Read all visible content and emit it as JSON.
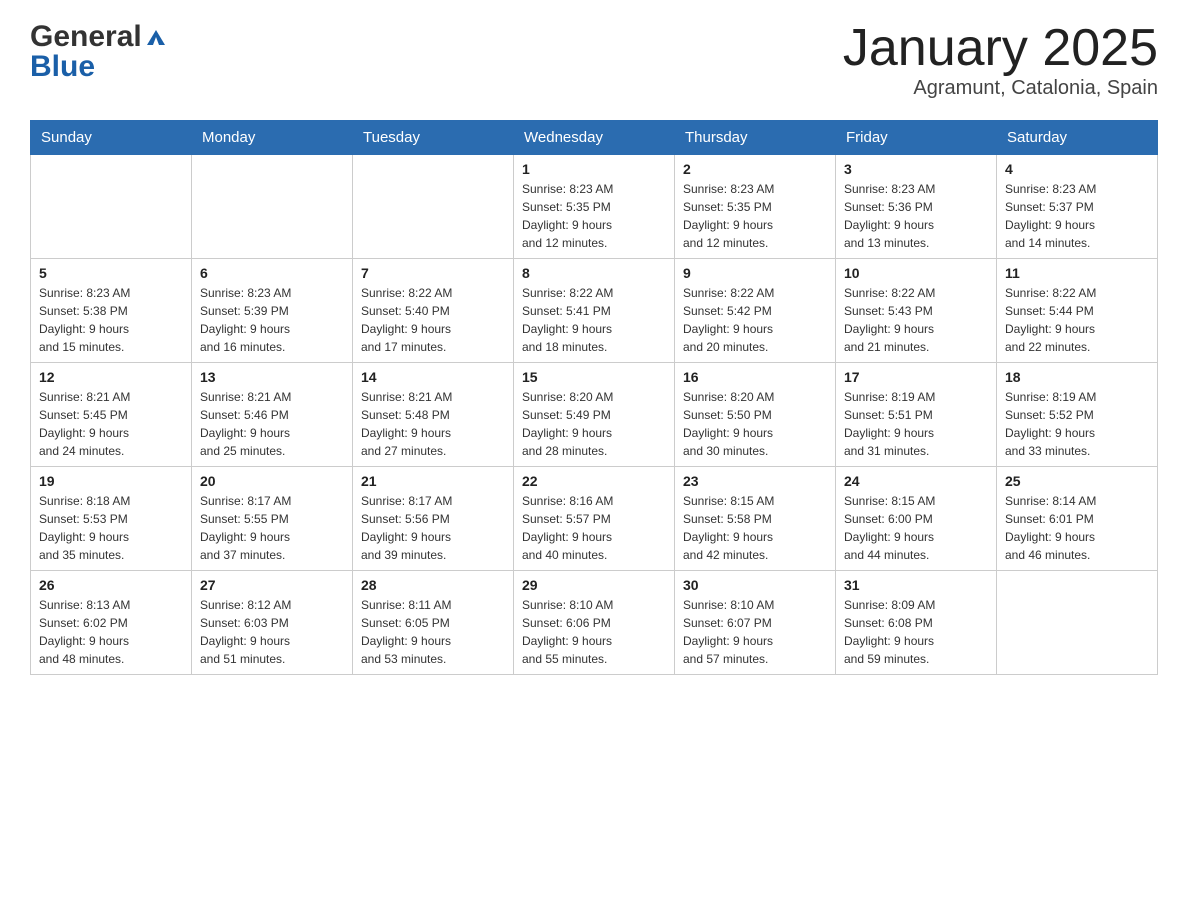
{
  "header": {
    "logo_general": "General",
    "logo_blue": "Blue",
    "title": "January 2025",
    "subtitle": "Agramunt, Catalonia, Spain"
  },
  "calendar": {
    "days_of_week": [
      "Sunday",
      "Monday",
      "Tuesday",
      "Wednesday",
      "Thursday",
      "Friday",
      "Saturday"
    ],
    "weeks": [
      [
        {
          "day": "",
          "info": ""
        },
        {
          "day": "",
          "info": ""
        },
        {
          "day": "",
          "info": ""
        },
        {
          "day": "1",
          "info": "Sunrise: 8:23 AM\nSunset: 5:35 PM\nDaylight: 9 hours\nand 12 minutes."
        },
        {
          "day": "2",
          "info": "Sunrise: 8:23 AM\nSunset: 5:35 PM\nDaylight: 9 hours\nand 12 minutes."
        },
        {
          "day": "3",
          "info": "Sunrise: 8:23 AM\nSunset: 5:36 PM\nDaylight: 9 hours\nand 13 minutes."
        },
        {
          "day": "4",
          "info": "Sunrise: 8:23 AM\nSunset: 5:37 PM\nDaylight: 9 hours\nand 14 minutes."
        }
      ],
      [
        {
          "day": "5",
          "info": "Sunrise: 8:23 AM\nSunset: 5:38 PM\nDaylight: 9 hours\nand 15 minutes."
        },
        {
          "day": "6",
          "info": "Sunrise: 8:23 AM\nSunset: 5:39 PM\nDaylight: 9 hours\nand 16 minutes."
        },
        {
          "day": "7",
          "info": "Sunrise: 8:22 AM\nSunset: 5:40 PM\nDaylight: 9 hours\nand 17 minutes."
        },
        {
          "day": "8",
          "info": "Sunrise: 8:22 AM\nSunset: 5:41 PM\nDaylight: 9 hours\nand 18 minutes."
        },
        {
          "day": "9",
          "info": "Sunrise: 8:22 AM\nSunset: 5:42 PM\nDaylight: 9 hours\nand 20 minutes."
        },
        {
          "day": "10",
          "info": "Sunrise: 8:22 AM\nSunset: 5:43 PM\nDaylight: 9 hours\nand 21 minutes."
        },
        {
          "day": "11",
          "info": "Sunrise: 8:22 AM\nSunset: 5:44 PM\nDaylight: 9 hours\nand 22 minutes."
        }
      ],
      [
        {
          "day": "12",
          "info": "Sunrise: 8:21 AM\nSunset: 5:45 PM\nDaylight: 9 hours\nand 24 minutes."
        },
        {
          "day": "13",
          "info": "Sunrise: 8:21 AM\nSunset: 5:46 PM\nDaylight: 9 hours\nand 25 minutes."
        },
        {
          "day": "14",
          "info": "Sunrise: 8:21 AM\nSunset: 5:48 PM\nDaylight: 9 hours\nand 27 minutes."
        },
        {
          "day": "15",
          "info": "Sunrise: 8:20 AM\nSunset: 5:49 PM\nDaylight: 9 hours\nand 28 minutes."
        },
        {
          "day": "16",
          "info": "Sunrise: 8:20 AM\nSunset: 5:50 PM\nDaylight: 9 hours\nand 30 minutes."
        },
        {
          "day": "17",
          "info": "Sunrise: 8:19 AM\nSunset: 5:51 PM\nDaylight: 9 hours\nand 31 minutes."
        },
        {
          "day": "18",
          "info": "Sunrise: 8:19 AM\nSunset: 5:52 PM\nDaylight: 9 hours\nand 33 minutes."
        }
      ],
      [
        {
          "day": "19",
          "info": "Sunrise: 8:18 AM\nSunset: 5:53 PM\nDaylight: 9 hours\nand 35 minutes."
        },
        {
          "day": "20",
          "info": "Sunrise: 8:17 AM\nSunset: 5:55 PM\nDaylight: 9 hours\nand 37 minutes."
        },
        {
          "day": "21",
          "info": "Sunrise: 8:17 AM\nSunset: 5:56 PM\nDaylight: 9 hours\nand 39 minutes."
        },
        {
          "day": "22",
          "info": "Sunrise: 8:16 AM\nSunset: 5:57 PM\nDaylight: 9 hours\nand 40 minutes."
        },
        {
          "day": "23",
          "info": "Sunrise: 8:15 AM\nSunset: 5:58 PM\nDaylight: 9 hours\nand 42 minutes."
        },
        {
          "day": "24",
          "info": "Sunrise: 8:15 AM\nSunset: 6:00 PM\nDaylight: 9 hours\nand 44 minutes."
        },
        {
          "day": "25",
          "info": "Sunrise: 8:14 AM\nSunset: 6:01 PM\nDaylight: 9 hours\nand 46 minutes."
        }
      ],
      [
        {
          "day": "26",
          "info": "Sunrise: 8:13 AM\nSunset: 6:02 PM\nDaylight: 9 hours\nand 48 minutes."
        },
        {
          "day": "27",
          "info": "Sunrise: 8:12 AM\nSunset: 6:03 PM\nDaylight: 9 hours\nand 51 minutes."
        },
        {
          "day": "28",
          "info": "Sunrise: 8:11 AM\nSunset: 6:05 PM\nDaylight: 9 hours\nand 53 minutes."
        },
        {
          "day": "29",
          "info": "Sunrise: 8:10 AM\nSunset: 6:06 PM\nDaylight: 9 hours\nand 55 minutes."
        },
        {
          "day": "30",
          "info": "Sunrise: 8:10 AM\nSunset: 6:07 PM\nDaylight: 9 hours\nand 57 minutes."
        },
        {
          "day": "31",
          "info": "Sunrise: 8:09 AM\nSunset: 6:08 PM\nDaylight: 9 hours\nand 59 minutes."
        },
        {
          "day": "",
          "info": ""
        }
      ]
    ]
  }
}
